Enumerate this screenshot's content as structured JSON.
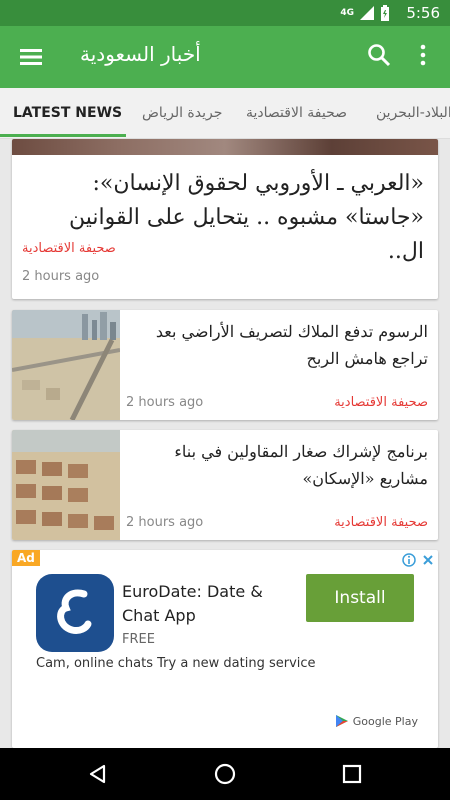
{
  "status": {
    "time": "5:56",
    "network": "4G"
  },
  "appbar": {
    "title": "أخبار السعودية"
  },
  "tabs": [
    "LATEST NEWS",
    "جريدة الرياض",
    "صحيفة الاقتصادية",
    "البلاد-البحرين"
  ],
  "hero": {
    "title": "«العربي ـ الأوروبي لحقوق الإنسان»: «جاستا» مشبوه .. يتحايل على القوانين ال..",
    "source": "صحيفة الاقتصادية",
    "time": "2 hours ago"
  },
  "articles": [
    {
      "title": "الرسوم تدفع الملاك لتصريف الأراضي بعد تراجع هامش الربح",
      "time": "2 hours ago",
      "source": "صحيفة الاقتصادية"
    },
    {
      "title": "برنامج لإشراك صغار المقاولين في بناء مشاريع «الإسكان»",
      "time": "2 hours ago",
      "source": "صحيفة الاقتصادية"
    }
  ],
  "ad": {
    "badge": "Ad",
    "app_title": "EuroDate: Date & Chat App",
    "price": "FREE",
    "install": "Install",
    "description": "Cam, online chats Try a new dating service",
    "store": "Google Play"
  }
}
